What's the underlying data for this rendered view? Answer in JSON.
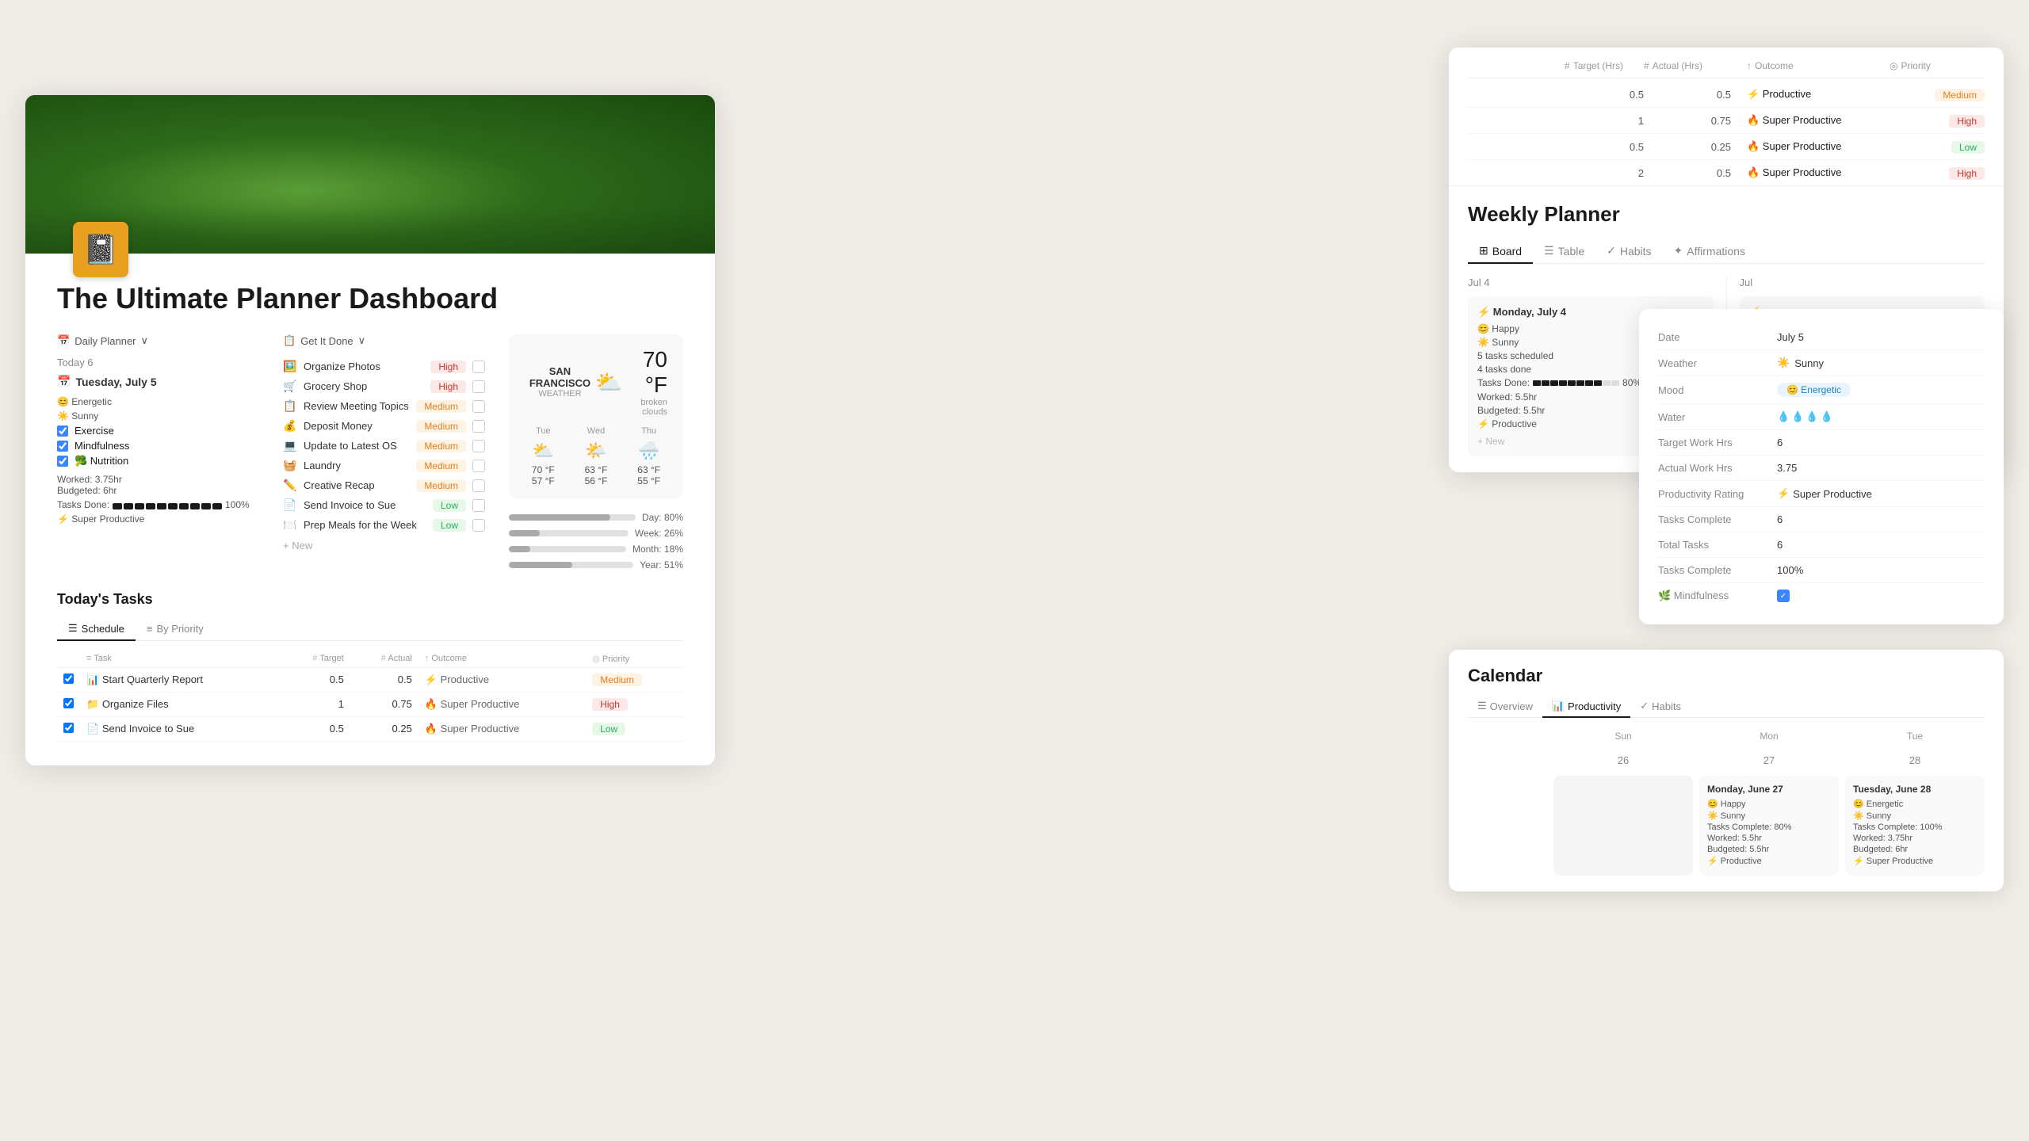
{
  "dashboard": {
    "title": "The Ultimate Planner Dashboard",
    "icon": "📓"
  },
  "daily_planner": {
    "section_label": "Daily Planner",
    "today_label": "Today  6",
    "date": "Tuesday, July 5",
    "mood": "😊 Energetic",
    "weather_today": "☀️ Sunny",
    "habits": [
      {
        "icon": "☑️",
        "name": "Exercise",
        "checked": true
      },
      {
        "icon": "☑️",
        "name": "Mindfulness",
        "checked": true
      },
      {
        "icon": "☑️",
        "name": "🥦 Nutrition",
        "checked": true
      }
    ],
    "worked": "Worked: 3.75hr",
    "budgeted": "Budgeted: 6hr",
    "productivity": "⚡ Super Productive",
    "tasks_done_label": "Tasks Done:",
    "tasks_done_pct": "100%",
    "tasks_blocks_filled": 10,
    "tasks_blocks_total": 10
  },
  "get_it_done": {
    "section_label": "Get It Done",
    "tasks": [
      {
        "icon": "🖼️",
        "name": "Organize Photos",
        "priority": "High",
        "checked": false
      },
      {
        "icon": "🛒",
        "name": "Grocery Shop",
        "priority": "High",
        "checked": false
      },
      {
        "icon": "📋",
        "name": "Review Meeting Topics",
        "priority": "Medium",
        "checked": false
      },
      {
        "icon": "💰",
        "name": "Deposit Money",
        "priority": "Medium",
        "checked": false
      },
      {
        "icon": "💻",
        "name": "Update to Latest OS",
        "priority": "Medium",
        "checked": false
      },
      {
        "icon": "🧺",
        "name": "Laundry",
        "priority": "Medium",
        "checked": false
      },
      {
        "icon": "✏️",
        "name": "Creative Recap",
        "priority": "Medium",
        "checked": false
      },
      {
        "icon": "📄",
        "name": "Send Invoice to Sue",
        "priority": "Low",
        "checked": false
      },
      {
        "icon": "🍽️",
        "name": "Prep Meals for the Week",
        "priority": "Low",
        "checked": false
      }
    ],
    "add_new": "+ New"
  },
  "weather": {
    "city": "SAN FRANCISCO",
    "label": "WEATHER",
    "temperature": "70 °F",
    "description": "broken clouds",
    "icon": "⛅",
    "days": [
      {
        "label": "Tue",
        "icon": "⛅",
        "high": "70 °F",
        "low": "57 °F"
      },
      {
        "label": "Wed",
        "icon": "🌤️",
        "high": "63 °F",
        "low": "56 °F"
      },
      {
        "label": "Thu",
        "icon": "🌧️",
        "high": "63 °F",
        "low": "55 °F"
      }
    ]
  },
  "progress_bars": [
    {
      "label": "Day: 80%",
      "pct": 80
    },
    {
      "label": "Week: 26%",
      "pct": 26
    },
    {
      "label": "Month: 18%",
      "pct": 18
    },
    {
      "label": "Year: 51%",
      "pct": 51
    }
  ],
  "todays_tasks": {
    "title": "Today's Tasks",
    "tabs": [
      "Schedule",
      "By Priority"
    ],
    "active_tab": "Schedule",
    "columns": [
      "Task",
      "Target",
      "Actual",
      "Outcome",
      "Priority"
    ],
    "rows": [
      {
        "checked": true,
        "icon": "📊",
        "name": "Start Quarterly Report",
        "target": "0.5",
        "actual": "0.5",
        "outcome": "⚡ Productive",
        "priority": "Medium",
        "p_class": "p-medium"
      },
      {
        "checked": true,
        "icon": "📁",
        "name": "Organize Files",
        "target": "1",
        "actual": "0.75",
        "outcome": "🔥 Super Productive",
        "priority": "High",
        "p_class": "p-high"
      },
      {
        "checked": true,
        "icon": "📄",
        "name": "Send Invoice to Sue",
        "target": "0.5",
        "actual": "0.25",
        "outcome": "🔥 Super Productive",
        "priority": "Low",
        "p_class": "p-low"
      }
    ]
  },
  "weekly_planner": {
    "title": "Weekly Planner",
    "tabs": [
      "Board",
      "Table",
      "Habits",
      "Affirmations"
    ],
    "active_tab": "Board",
    "top_table": {
      "columns": [
        "Target (Hrs)",
        "Actual (Hrs)",
        "Outcome",
        "Priority"
      ],
      "rows": [
        {
          "target": "0.5",
          "actual": "0.5",
          "outcome": "⚡ Productive",
          "priority": "Medium",
          "p_class": "p-medium"
        },
        {
          "target": "1",
          "actual": "0.75",
          "outcome": "🔥 Super Productive",
          "priority": "High",
          "p_class": "p-high"
        },
        {
          "target": "0.5",
          "actual": "0.25",
          "outcome": "🔥 Super Productive",
          "priority": "Low",
          "p_class": "p-low"
        },
        {
          "target": "2",
          "actual": "0.5",
          "outcome": "🔥 Super Productive",
          "priority": "High",
          "p_class": "p-high"
        }
      ]
    },
    "board_cols": [
      {
        "date": "Jul 4",
        "day_title": "⚡ Monday, July 4",
        "mood": "😊 Happy",
        "weather": "☀️ Sunny",
        "tasks_scheduled": "5 tasks scheduled",
        "tasks_done": "4 tasks done",
        "tasks_bar_filled": 8,
        "tasks_bar_total": 10,
        "tasks_bar_pct": "80%",
        "worked": "Worked: 5.5hr",
        "budgeted": "Budgeted: 5.5hr",
        "productivity": "⚡ Productive",
        "new_label": "+ New"
      }
    ]
  },
  "detail_panel": {
    "date_label": "Date",
    "date_value": "July 5",
    "weather_label": "Weather",
    "weather_value": "☀️ Sunny",
    "mood_label": "Mood",
    "mood_value": "😊 Energetic",
    "water_label": "Water",
    "water_value": "💧💧💧💧",
    "target_work_label": "Target Work Hrs",
    "target_work_value": "6",
    "actual_work_label": "Actual Work Hrs",
    "actual_work_value": "3.75",
    "productivity_label": "Productivity Rating",
    "productivity_value": "⚡ Super Productive",
    "tasks_complete_label": "Tasks Complete",
    "tasks_complete_value": "6",
    "total_tasks_label": "Total Tasks",
    "total_tasks_value": "6",
    "tasks_complete_pct_label": "Tasks Complete",
    "tasks_complete_pct_value": "100%",
    "mindfulness_label": "🌿 Mindfulness",
    "mindfulness_checked": true
  },
  "calendar": {
    "title": "Calendar",
    "tabs": [
      "Overview",
      "Productivity",
      "Habits"
    ],
    "active_tab": "Productivity",
    "days_of_week": [
      "Sun",
      "Mon",
      "Tue"
    ],
    "dates": [
      "26",
      "27",
      "28"
    ],
    "day_cards": [
      {
        "date_num": "27",
        "title": "Monday, June 27",
        "mood": "😊 Happy",
        "weather": "☀️ Sunny",
        "tasks_complete": "Tasks Complete: 80%",
        "worked": "Worked: 5.5hr",
        "budgeted": "Budgeted: 5.5hr",
        "productivity": "⚡ Productive"
      },
      {
        "date_num": "28",
        "title": "Tuesday, June 28",
        "mood": "😊 Energetic",
        "weather": "☀️ Sunny",
        "tasks_complete": "Tasks Complete: 100%",
        "worked": "Worked: 3.75hr",
        "budgeted": "Budgeted: 6hr",
        "productivity": "⚡ Super Productive"
      }
    ]
  }
}
